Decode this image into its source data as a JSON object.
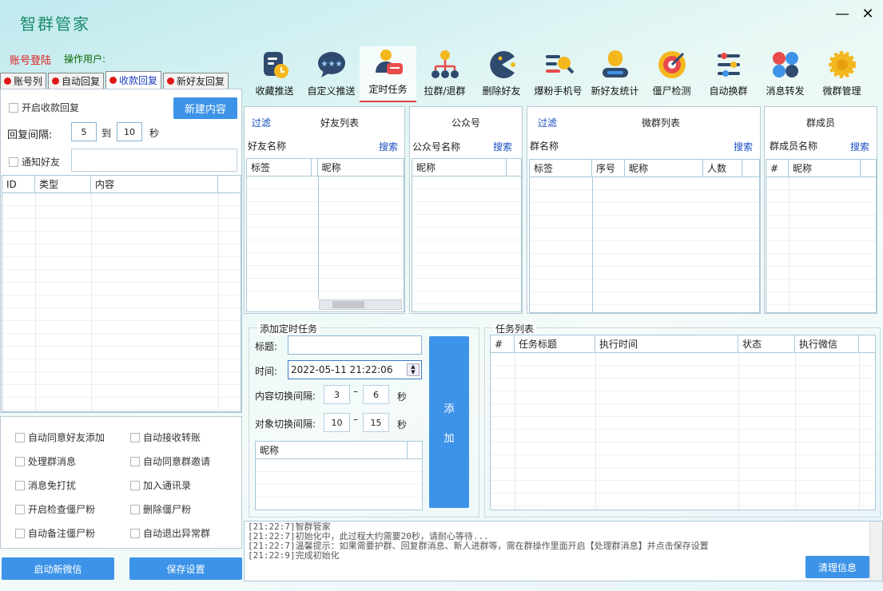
{
  "app": {
    "title": "智群管家",
    "minimize": "—",
    "close": "✕"
  },
  "account": {
    "login": "账号登陆",
    "operator": "操作用户:"
  },
  "toolbar": [
    {
      "label": "收藏推送",
      "icon": "bookmark-clock-icon"
    },
    {
      "label": "自定义推送",
      "icon": "chat-stars-icon"
    },
    {
      "label": "定时任务",
      "icon": "user-chat-icon"
    },
    {
      "label": "拉群/退群",
      "icon": "org-tree-icon"
    },
    {
      "label": "删除好友",
      "icon": "pacman-icon"
    },
    {
      "label": "爆粉手机号",
      "icon": "search-list-icon"
    },
    {
      "label": "新好友统计",
      "icon": "user-badge-icon"
    },
    {
      "label": "僵尸检测",
      "icon": "target-icon"
    },
    {
      "label": "自动换群",
      "icon": "sliders-icon"
    },
    {
      "label": "消息转发",
      "icon": "circles-icon"
    },
    {
      "label": "微群管理",
      "icon": "gear-icon"
    }
  ],
  "tabs": [
    "账号列",
    "自动回复",
    "收款回复",
    "新好友回复"
  ],
  "left": {
    "enable_receipt_reply": "开启收款回复",
    "new_content": "新建内容",
    "reply_interval": "回复间隔:",
    "interval_from": "5",
    "to": "到",
    "interval_to": "10",
    "sec": "秒",
    "notify_friend": "通知好友",
    "table_headers": [
      "ID",
      "类型",
      "内容"
    ]
  },
  "options": [
    [
      "自动同意好友添加",
      "自动接收转账"
    ],
    [
      "处理群消息",
      "自动同意群邀请"
    ],
    [
      "消息免打扰",
      "加入通讯录"
    ],
    [
      "开启检查僵尸粉",
      "删除僵尸粉"
    ],
    [
      "自动备注僵尸粉",
      "自动退出异常群"
    ]
  ],
  "buttons": {
    "start_wechat": "启动新微信",
    "save_settings": "保存设置",
    "clear_info": "清理信息"
  },
  "friends": {
    "filter": "过滤",
    "title": "好友列表",
    "search_label": "好友名称",
    "search": "搜索",
    "headers": [
      "标签",
      "昵称"
    ]
  },
  "official": {
    "title": "公众号",
    "search_label": "公众号名称",
    "search": "搜索",
    "headers": [
      "昵称"
    ]
  },
  "groups": {
    "filter": "过滤",
    "title": "微群列表",
    "search_label": "群名称",
    "search": "搜索",
    "headers": [
      "标签",
      "序号",
      "昵称",
      "人数"
    ]
  },
  "members": {
    "title": "群成员",
    "search_label": "群成员名称",
    "search": "搜索",
    "headers": [
      "#",
      "昵称"
    ]
  },
  "add_task": {
    "legend": "添加定时任务",
    "title_label": "标题:",
    "time_label": "时间:",
    "time_value": "2022-05-11 21:22:06",
    "content_interval": "内容切换间隔:",
    "ci_from": "3",
    "ci_to": "6",
    "object_interval": "对象切换间隔:",
    "oi_from": "10",
    "oi_to": "15",
    "dash": "–",
    "sec": "秒",
    "nick_header": "昵称",
    "add_btn_1": "添",
    "add_btn_2": "加"
  },
  "tasks": {
    "legend": "任务列表",
    "headers": [
      "#",
      "任务标题",
      "执行时间",
      "状态",
      "执行微信"
    ]
  },
  "log": [
    "[21:22:7]智群管家",
    "[21:22:7]初始化中，此过程大约需要20秒，请耐心等待...",
    "[21:22:7]温馨提示：如果需要护群、回复群消息、新人进群等，需在群操作里面开启【处理群消息】并点击保存设置",
    "[21:22:9]完成初始化"
  ]
}
